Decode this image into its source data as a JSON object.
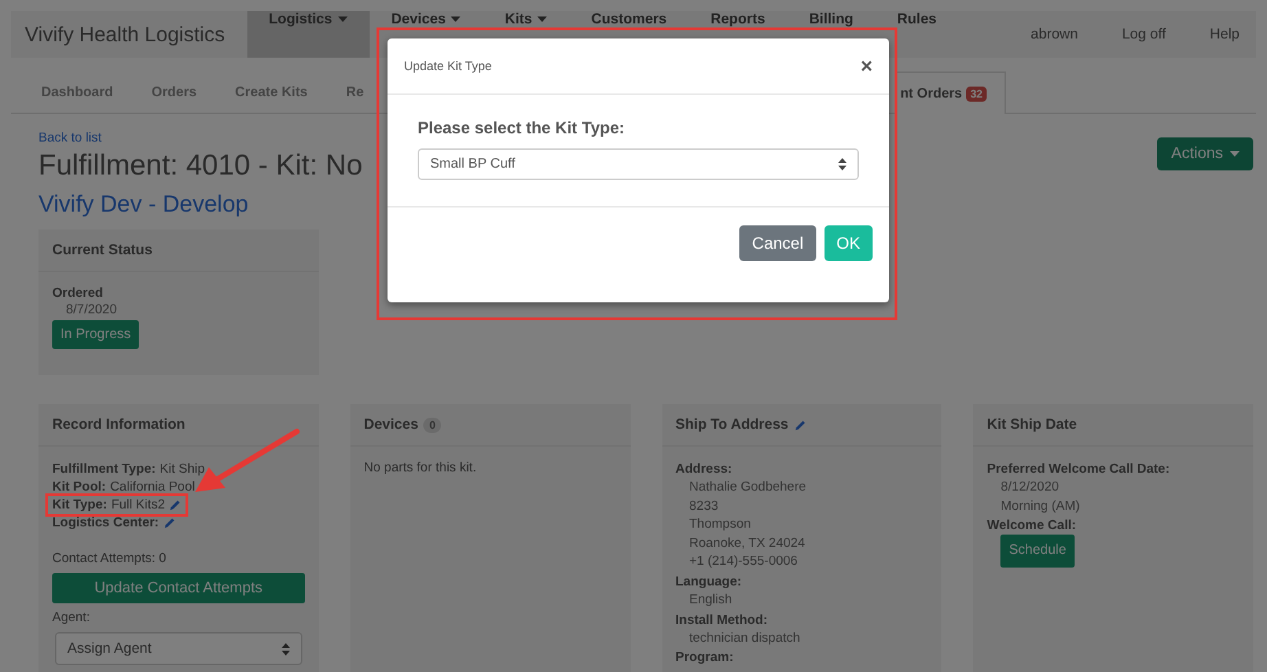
{
  "navbar": {
    "brand": "Vivify Health Logistics",
    "items": [
      {
        "label": "Logistics",
        "dropdown": true,
        "selected": true
      },
      {
        "label": "Devices",
        "dropdown": true,
        "selected": false
      },
      {
        "label": "Kits",
        "dropdown": true,
        "selected": false
      },
      {
        "label": "Customers",
        "dropdown": false,
        "selected": false
      },
      {
        "label": "Reports",
        "dropdown": false,
        "selected": false
      },
      {
        "label": "Billing",
        "dropdown": false,
        "selected": false
      },
      {
        "label": "Rules",
        "dropdown": false,
        "selected": false
      }
    ],
    "user_links": [
      "abrown",
      "Log off",
      "Help"
    ]
  },
  "tabs": [
    {
      "label": "Dashboard",
      "selected": false
    },
    {
      "label": "Orders",
      "selected": false
    },
    {
      "label": "Create Kits",
      "selected": false
    },
    {
      "label": "Re",
      "selected": false
    },
    {
      "label": "nt Orders",
      "badge": "32",
      "selected": true
    }
  ],
  "back_link": "Back to list",
  "title": "Fulfillment: 4010 - Kit: No",
  "subtitle": "Vivify Dev - Develop",
  "actions_button": "Actions",
  "current_status": {
    "heading": "Current Status",
    "label": "Ordered",
    "date": "8/7/2020",
    "status": "In Progress"
  },
  "record_information": {
    "heading": "Record Information",
    "fields": [
      {
        "label": "Fulfillment Type:",
        "value": "Kit Ship",
        "editable": false,
        "highlighted": false
      },
      {
        "label": "Kit Pool:",
        "value": "California Pool",
        "editable": false,
        "highlighted": false
      },
      {
        "label": "Kit Type:",
        "value": "Full Kits2",
        "editable": true,
        "highlighted": true
      },
      {
        "label": "Logistics Center:",
        "editable": true,
        "highlighted": false
      }
    ],
    "contact_attempts": "Contact Attempts: 0",
    "update_button": "Update Contact Attempts",
    "agent_label": "Agent:",
    "agent_select": "Assign Agent"
  },
  "devices": {
    "heading": "Devices",
    "count": "0",
    "empty_text": "No parts for this kit."
  },
  "ship_to": {
    "heading": "Ship To Address",
    "editable": true,
    "groups": [
      {
        "label": "Address:",
        "lines": [
          "Nathalie Godbehere",
          "8233",
          "Thompson",
          "Roanoke, TX 24024",
          "+1 (214)-555-0006"
        ]
      },
      {
        "label": "Language:",
        "lines": [
          "English"
        ]
      },
      {
        "label": "Install Method:",
        "lines": [
          "technician dispatch"
        ]
      },
      {
        "label": "Program:"
      }
    ]
  },
  "kit_ship_date": {
    "heading": "Kit Ship Date",
    "groups": [
      {
        "label": "Preferred Welcome Call Date:",
        "lines": [
          "8/12/2020",
          "Morning (AM)"
        ]
      },
      {
        "label": "Welcome Call:",
        "button": "Schedule"
      }
    ]
  },
  "modal": {
    "title": "Update Kit Type",
    "close": "×",
    "prompt": "Please select the Kit Type:",
    "select_value": "Small BP Cuff",
    "highlighted": true,
    "buttons": [
      {
        "label": "Cancel",
        "kind": "secondary"
      },
      {
        "label": "OK",
        "kind": "primary"
      }
    ]
  }
}
